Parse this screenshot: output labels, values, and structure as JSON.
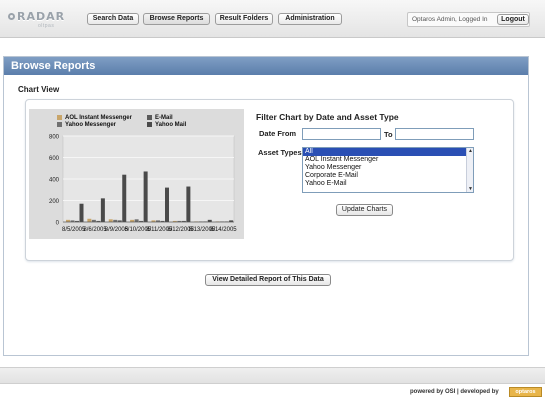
{
  "app": {
    "logo_text": "RADAR",
    "logo_sub": "oltpas"
  },
  "nav": {
    "items": [
      "Search Data",
      "Browse Reports",
      "Result Folders",
      "Administration"
    ],
    "active": "Browse Reports"
  },
  "user": {
    "status": "Optaros Admin, Logged In",
    "logout_label": "Logout"
  },
  "page": {
    "title": "Browse Reports",
    "chart_view_label": "Chart View"
  },
  "filter": {
    "title": "Filter Chart by Date and Asset Type",
    "date_from_label": "Date From",
    "date_from_value": "",
    "to_label": "To",
    "date_to_value": "",
    "asset_types_label": "Asset Types",
    "asset_types": [
      "All",
      "AOL Instant Messenger",
      "Yahoo Messenger",
      "Corporate E-Mail",
      "Yahoo E-Mail"
    ],
    "selected": "All",
    "update_button": "Update Charts"
  },
  "detail_button": "View Detailed Report of This Data",
  "footer": {
    "powered_by": "powered by OSI | developed by",
    "badge": "optaros"
  },
  "chart_data": {
    "type": "bar",
    "categories": [
      "8/5/2005",
      "8/6/2005",
      "8/9/2005",
      "8/10/2005",
      "8/11/2005",
      "8/12/2005",
      "8/13/2005",
      "8/14/2005"
    ],
    "series": [
      {
        "name": "AOL Instant Messenger",
        "values": [
          20,
          30,
          25,
          20,
          15,
          10,
          5,
          5
        ],
        "color": "#c8a56a"
      },
      {
        "name": "Yahoo Messenger",
        "values": [
          15,
          20,
          20,
          25,
          15,
          10,
          5,
          5
        ],
        "color": "#707070"
      },
      {
        "name": "E-Mail",
        "values": [
          10,
          10,
          15,
          10,
          10,
          10,
          5,
          5
        ],
        "color": "#5a5a5a"
      },
      {
        "name": "Yahoo Mail",
        "values": [
          170,
          220,
          440,
          470,
          320,
          330,
          20,
          15
        ],
        "color": "#4a4a4a"
      }
    ],
    "yticks": [
      0,
      200,
      400,
      600,
      800
    ],
    "ylim": [
      0,
      800
    ],
    "grid": true,
    "legend": "top"
  }
}
